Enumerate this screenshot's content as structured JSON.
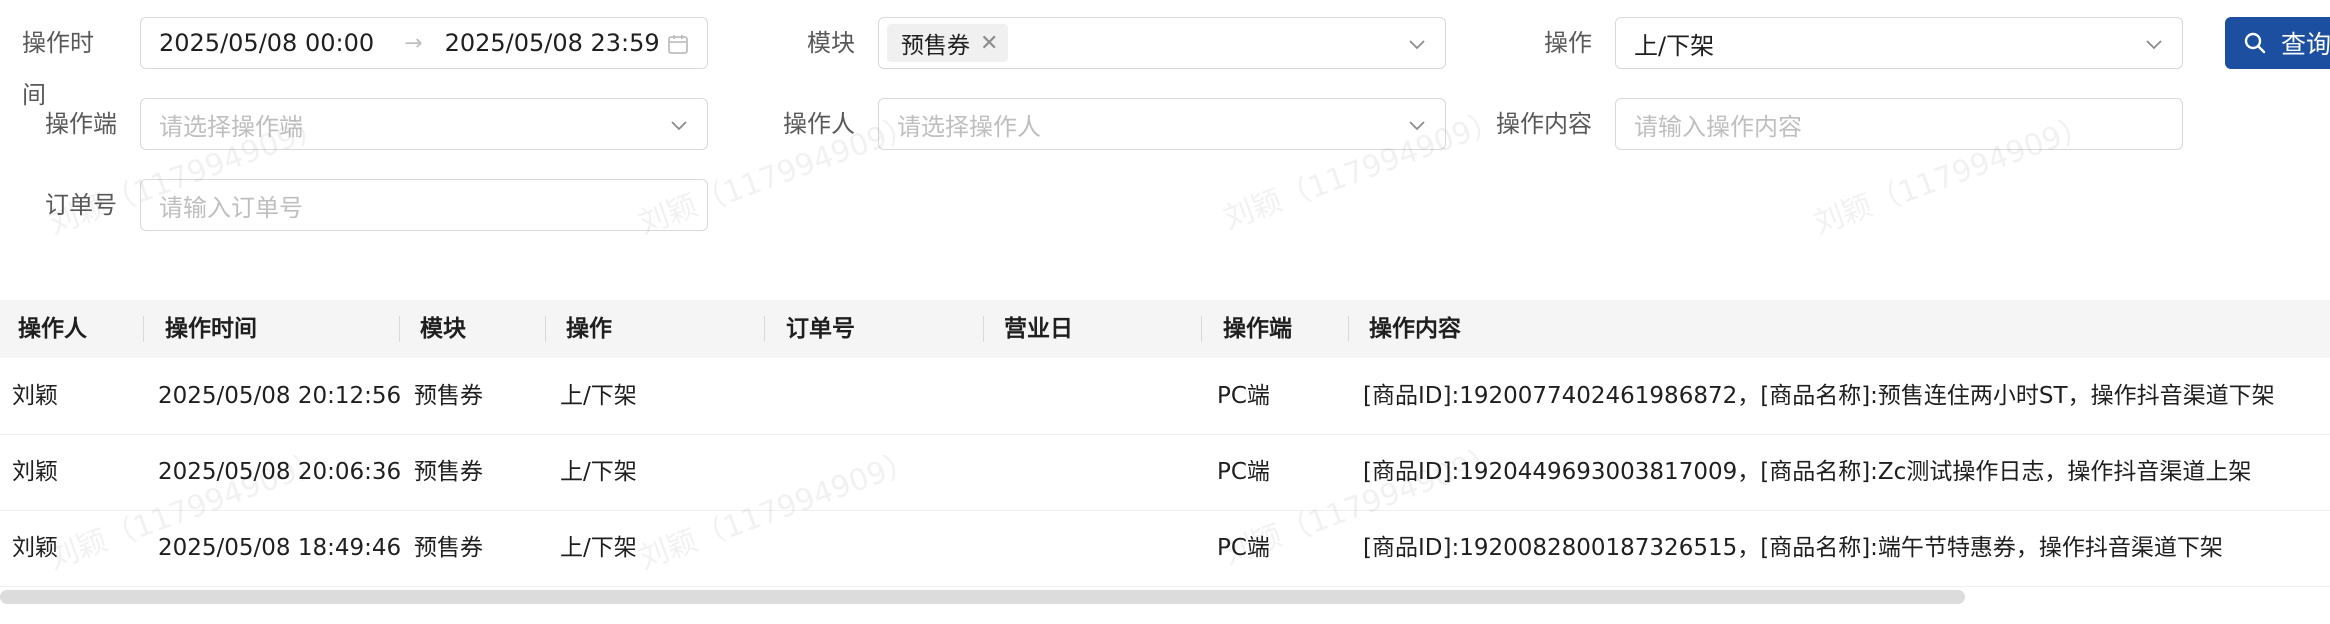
{
  "filters": {
    "op_time_label": "操作时间",
    "op_time_start": "2025/05/08 00:00",
    "op_time_end": "2025/05/08 23:59",
    "module_label": "模块",
    "module_tag": "预售券",
    "operation_label": "操作",
    "operation_value": "上/下架",
    "query_button": "查询",
    "op_client_label": "操作端",
    "op_client_placeholder": "请选择操作端",
    "operator_label": "操作人",
    "operator_placeholder": "请选择操作人",
    "op_content_label": "操作内容",
    "op_content_placeholder": "请输入操作内容",
    "order_no_label": "订单号",
    "order_no_placeholder": "请输入订单号"
  },
  "table": {
    "columns": [
      "操作人",
      "操作时间",
      "模块",
      "操作",
      "订单号",
      "营业日",
      "操作端",
      "操作内容"
    ],
    "rows": [
      [
        "刘颖",
        "2025/05/08 20:12:56",
        "预售券",
        "上/下架",
        "",
        "",
        "PC端",
        "[商品ID]:1920077402461986872，[商品名称]:预售连住两小时ST，操作抖音渠道下架"
      ],
      [
        "刘颖",
        "2025/05/08 20:06:36",
        "预售券",
        "上/下架",
        "",
        "",
        "PC端",
        "[商品ID]:1920449693003817009，[商品名称]:Zc测试操作日志，操作抖音渠道上架"
      ],
      [
        "刘颖",
        "2025/05/08 18:49:46",
        "预售券",
        "上/下架",
        "",
        "",
        "PC端",
        "[商品ID]:1920082800187326515，[商品名称]:端午节特惠券，操作抖音渠道下架"
      ]
    ]
  },
  "watermark": "刘颖（117994909）",
  "colors": {
    "primary": "#1d4fa1",
    "header_bg": "#f5f5f5",
    "border": "#d9d9d9",
    "placeholder": "#bfbfbf"
  }
}
